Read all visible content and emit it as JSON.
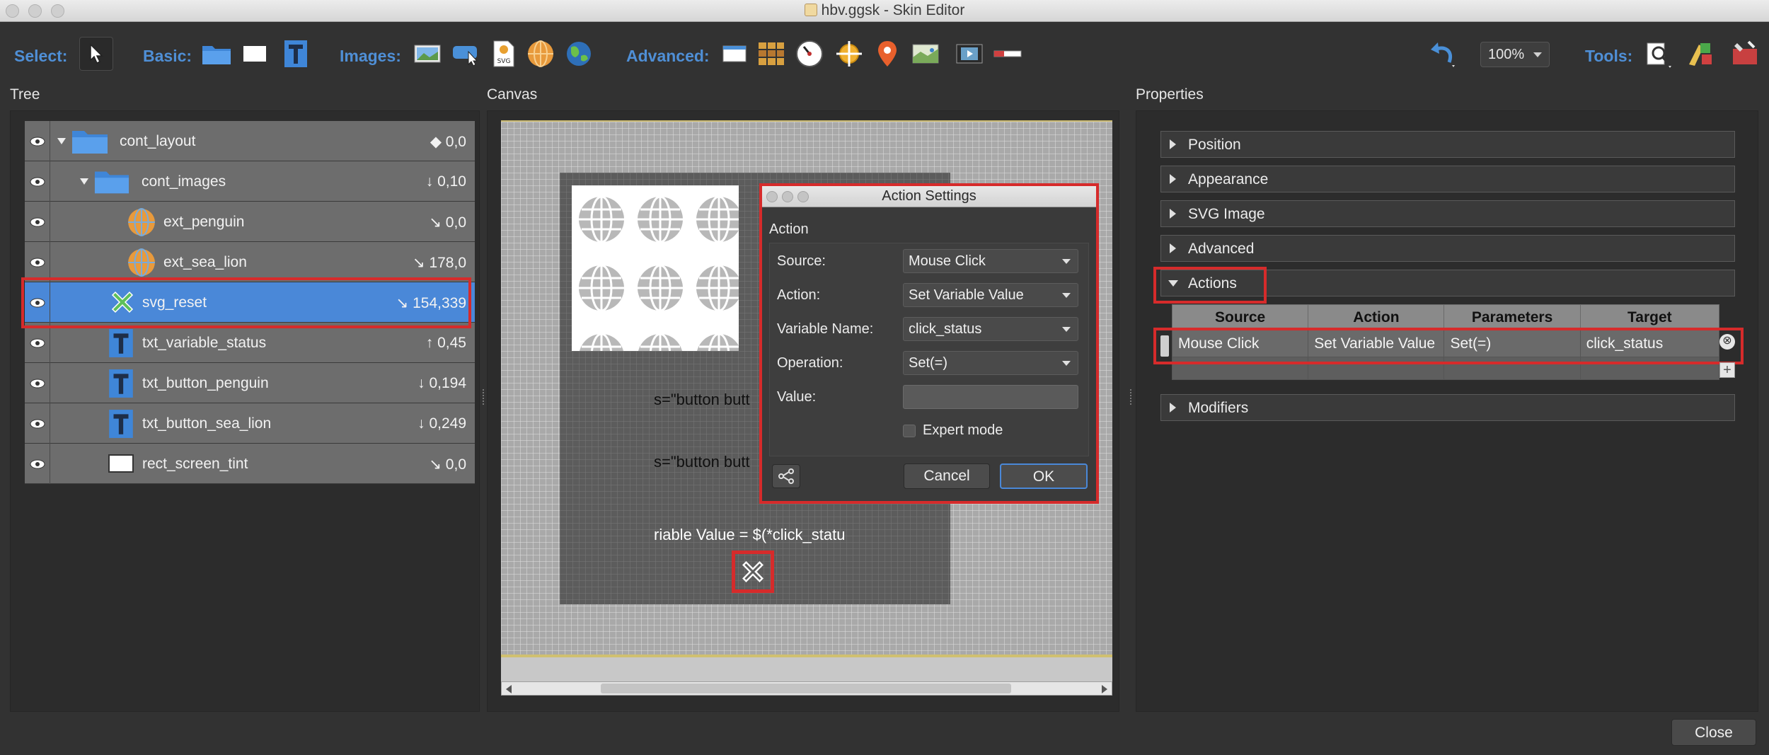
{
  "window": {
    "title": "hbv.ggsk - Skin Editor"
  },
  "toolbar": {
    "select_label": "Select:",
    "basic_label": "Basic:",
    "images_label": "Images:",
    "advanced_label": "Advanced:",
    "tools_label": "Tools:",
    "zoom_value": "100%"
  },
  "sections": {
    "tree": "Tree",
    "canvas": "Canvas",
    "properties": "Properties"
  },
  "tree": {
    "items": [
      {
        "name": "cont_layout",
        "value": "◆ 0,0"
      },
      {
        "name": "cont_images",
        "value": "↓ 0,10"
      },
      {
        "name": "ext_penguin",
        "value": "↘ 0,0"
      },
      {
        "name": "ext_sea_lion",
        "value": "↘ 178,0"
      },
      {
        "name": "svg_reset",
        "value": "↘ 154,339"
      },
      {
        "name": "txt_variable_status",
        "value": "↑ 0,45"
      },
      {
        "name": "txt_button_penguin",
        "value": "↓ 0,194"
      },
      {
        "name": "txt_button_sea_lion",
        "value": "↓ 0,249"
      },
      {
        "name": "rect_screen_tint",
        "value": "↘ 0,0"
      }
    ]
  },
  "canvas": {
    "text1": "s=\"button butt",
    "text2": "s=\"button butt",
    "text3": "riable Value = $(*click_statu"
  },
  "dialog": {
    "title": "Action Settings",
    "group_title": "Action",
    "source_label": "Source:",
    "source_value": "Mouse Click",
    "action_label": "Action:",
    "action_value": "Set Variable Value",
    "varname_label": "Variable Name:",
    "varname_value": "click_status",
    "operation_label": "Operation:",
    "operation_value": "Set(=)",
    "value_label": "Value:",
    "value_value": "",
    "expert_label": "Expert mode",
    "cancel": "Cancel",
    "ok": "OK"
  },
  "properties": {
    "sections": [
      "Position",
      "Appearance",
      "SVG Image",
      "Advanced",
      "Actions",
      "Modifiers"
    ],
    "table": {
      "headers": [
        "Source",
        "Action",
        "Parameters",
        "Target"
      ],
      "rows": [
        [
          "Mouse Click",
          "Set Variable Value",
          "Set(=)",
          "click_status"
        ]
      ]
    }
  },
  "footer": {
    "close": "Close"
  },
  "colors": {
    "accent": "#4a88d8",
    "highlight_red": "#d62b2b",
    "label_blue": "#4f8fd6"
  }
}
